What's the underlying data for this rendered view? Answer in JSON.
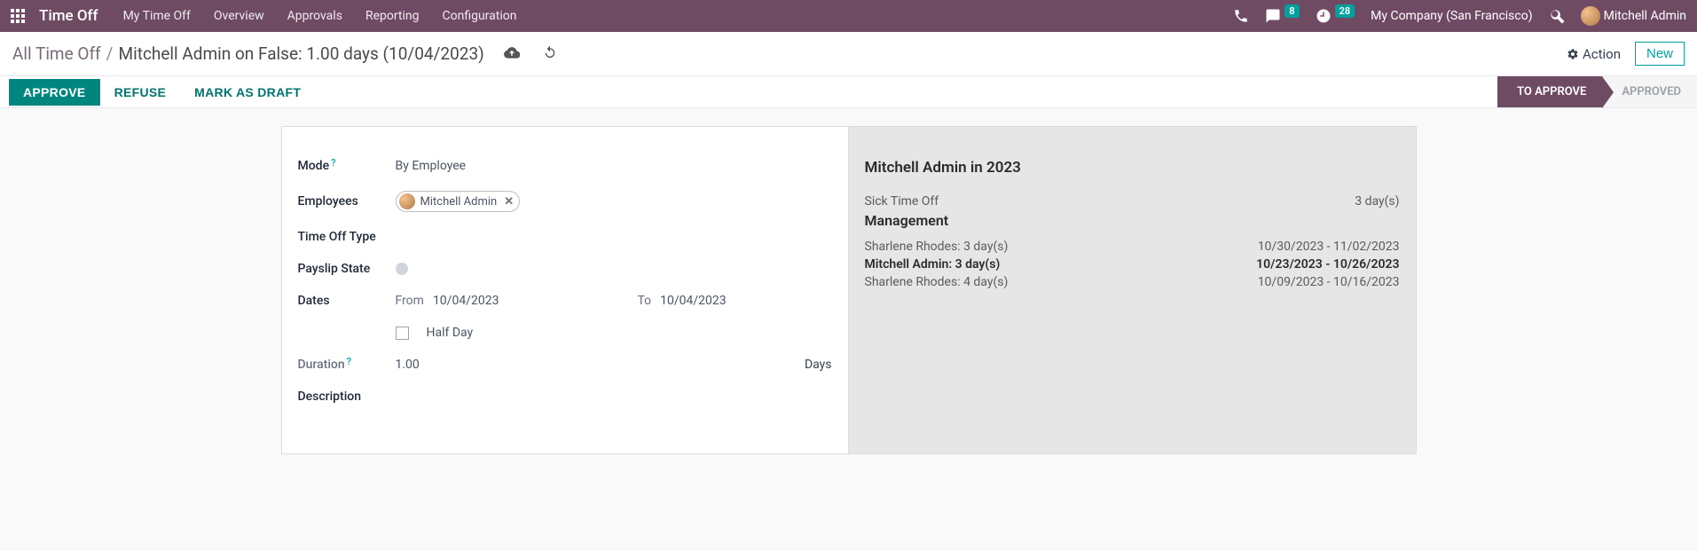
{
  "topbar": {
    "app_title": "Time Off",
    "nav": [
      "My Time Off",
      "Overview",
      "Approvals",
      "Reporting",
      "Configuration"
    ],
    "chat_badge": "8",
    "activity_badge": "28",
    "company": "My Company (San Francisco)",
    "user": "Mitchell Admin"
  },
  "subheader": {
    "breadcrumb_root": "All Time Off",
    "breadcrumb_sep": "/",
    "breadcrumb_current": "Mitchell Admin on False: 1.00 days (10/04/2023)",
    "action_label": "Action",
    "new_label": "New"
  },
  "statusbar": {
    "approve": "APPROVE",
    "refuse": "REFUSE",
    "mark_draft": "MARK AS DRAFT",
    "stage_current": "TO APPROVE",
    "stage_next": "APPROVED"
  },
  "form": {
    "mode_label": "Mode",
    "mode_value": "By Employee",
    "employees_label": "Employees",
    "employee_tag": "Mitchell Admin",
    "type_label": "Time Off Type",
    "payslip_label": "Payslip State",
    "dates_label": "Dates",
    "from_label": "From",
    "from_value": "10/04/2023",
    "to_label": "To",
    "to_value": "10/04/2023",
    "halfday_label": "Half Day",
    "duration_label": "Duration",
    "duration_value": "1.00",
    "duration_unit": "Days",
    "description_label": "Description"
  },
  "sidebar": {
    "title": "Mitchell Admin in 2023",
    "summary_name": "Sick Time Off",
    "summary_days": "3 day(s)",
    "section_title": "Management",
    "rows": [
      {
        "name": "Sharlene Rhodes: 3 day(s)",
        "range": "10/30/2023 - 11/02/2023",
        "bold": false
      },
      {
        "name": "Mitchell Admin: 3 day(s)",
        "range": "10/23/2023 - 10/26/2023",
        "bold": true
      },
      {
        "name": "Sharlene Rhodes: 4 day(s)",
        "range": "10/09/2023 - 10/16/2023",
        "bold": false
      }
    ]
  }
}
